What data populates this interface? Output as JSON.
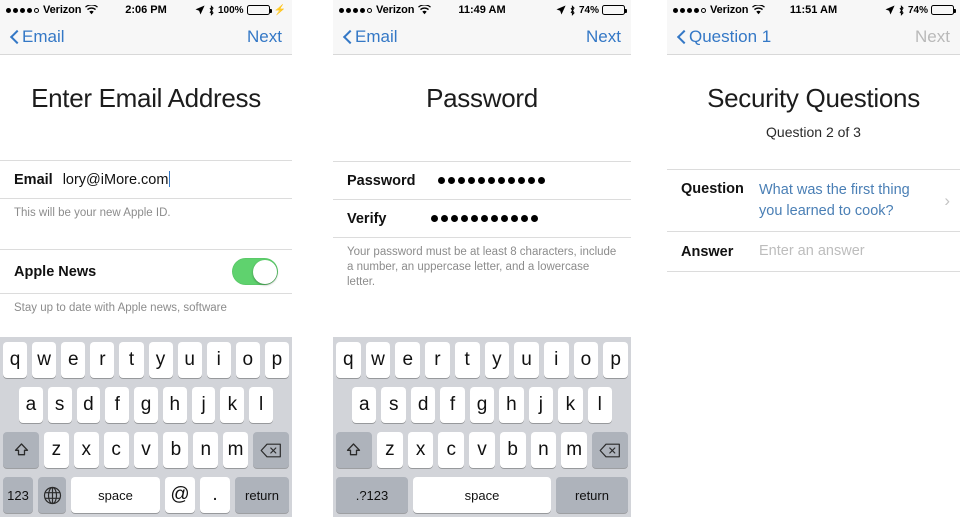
{
  "panels": [
    {
      "name": "email-panel",
      "status": {
        "carrier": "Verizon",
        "time": "2:06 PM",
        "battery_pct": "100%",
        "signal_filled": 4,
        "signal_hollow": 1,
        "wifi_icon": "wifi-icon",
        "location_icon": "location-arrow-icon",
        "bluetooth_icon": "bluetooth-icon",
        "battery_icon": "battery-icon",
        "charging_icon": "lightning-bolt-icon"
      },
      "nav": {
        "back_label": "Email",
        "back_icon": "chevron-left-icon",
        "action_label": "Next",
        "action_enabled": true
      },
      "title": "Enter Email Address",
      "subtitle": "",
      "rows": [
        {
          "label": "Email",
          "value": "lory@iMore.com",
          "type": "text-with-caret"
        }
      ],
      "footnote": "This will be your new Apple ID.",
      "toggle_row": {
        "label": "Apple News",
        "state": "on",
        "color": "#5fd26e"
      },
      "toggle_footnote": "Stay up to date with Apple news, software",
      "keyboard": {
        "row1": [
          "q",
          "w",
          "e",
          "r",
          "t",
          "y",
          "u",
          "i",
          "o",
          "p"
        ],
        "row2": [
          "a",
          "s",
          "d",
          "f",
          "g",
          "h",
          "j",
          "k",
          "l"
        ],
        "row3_shift": "shift-icon",
        "row3": [
          "z",
          "x",
          "c",
          "v",
          "b",
          "n",
          "m"
        ],
        "row3_delete": "delete-icon",
        "row4": [
          "123",
          "globe-icon",
          "space",
          "@",
          ".",
          "return"
        ]
      }
    },
    {
      "name": "password-panel",
      "status": {
        "carrier": "Verizon",
        "time": "11:49 AM",
        "battery_pct": "74%",
        "signal_filled": 4,
        "signal_hollow": 1,
        "wifi_icon": "wifi-icon",
        "location_icon": "location-arrow-icon",
        "bluetooth_icon": "bluetooth-icon",
        "battery_icon": "battery-icon",
        "charging_icon": ""
      },
      "nav": {
        "back_label": "Email",
        "back_icon": "chevron-left-icon",
        "action_label": "Next",
        "action_enabled": true
      },
      "title": "Password",
      "subtitle": "",
      "rows": [
        {
          "label": "Password",
          "value": "",
          "type": "secure",
          "dots": 11
        },
        {
          "label": "Verify",
          "value": "",
          "type": "secure",
          "dots": 11
        }
      ],
      "footnote": "Your password must be at least 8 characters, include a number, an uppercase letter, and a lowercase letter.",
      "keyboard": {
        "row1": [
          "q",
          "w",
          "e",
          "r",
          "t",
          "y",
          "u",
          "i",
          "o",
          "p"
        ],
        "row2": [
          "a",
          "s",
          "d",
          "f",
          "g",
          "h",
          "j",
          "k",
          "l"
        ],
        "row3_shift": "shift-icon",
        "row3": [
          "z",
          "x",
          "c",
          "v",
          "b",
          "n",
          "m"
        ],
        "row3_delete": "delete-icon",
        "row4": [
          ".?123",
          "space",
          "return"
        ]
      }
    },
    {
      "name": "security-questions-panel",
      "status": {
        "carrier": "Verizon",
        "time": "11:51 AM",
        "battery_pct": "74%",
        "signal_filled": 4,
        "signal_hollow": 1,
        "wifi_icon": "wifi-icon",
        "location_icon": "location-arrow-icon",
        "bluetooth_icon": "bluetooth-icon",
        "battery_icon": "battery-icon",
        "charging_icon": ""
      },
      "nav": {
        "back_label": "Question 1",
        "back_icon": "chevron-left-icon",
        "action_label": "Next",
        "action_enabled": false
      },
      "title": "Security Questions",
      "subtitle": "Question 2 of 3",
      "question_row": {
        "label": "Question",
        "value": "What was the first thing you learned to cook?",
        "disclosure_icon": "chevron-right-icon"
      },
      "answer_row": {
        "label": "Answer",
        "placeholder": "Enter an answer",
        "value": ""
      }
    }
  ],
  "colors": {
    "accent_blue": "#3478c6",
    "link_blue": "#4a7fb5",
    "toggle_green": "#5fd26e",
    "disabled_grey": "#b9b9b9",
    "keyboard_bg": "#d2d4d9",
    "key_dark": "#aeb3bb",
    "bar_bg": "#f7f7f7"
  }
}
